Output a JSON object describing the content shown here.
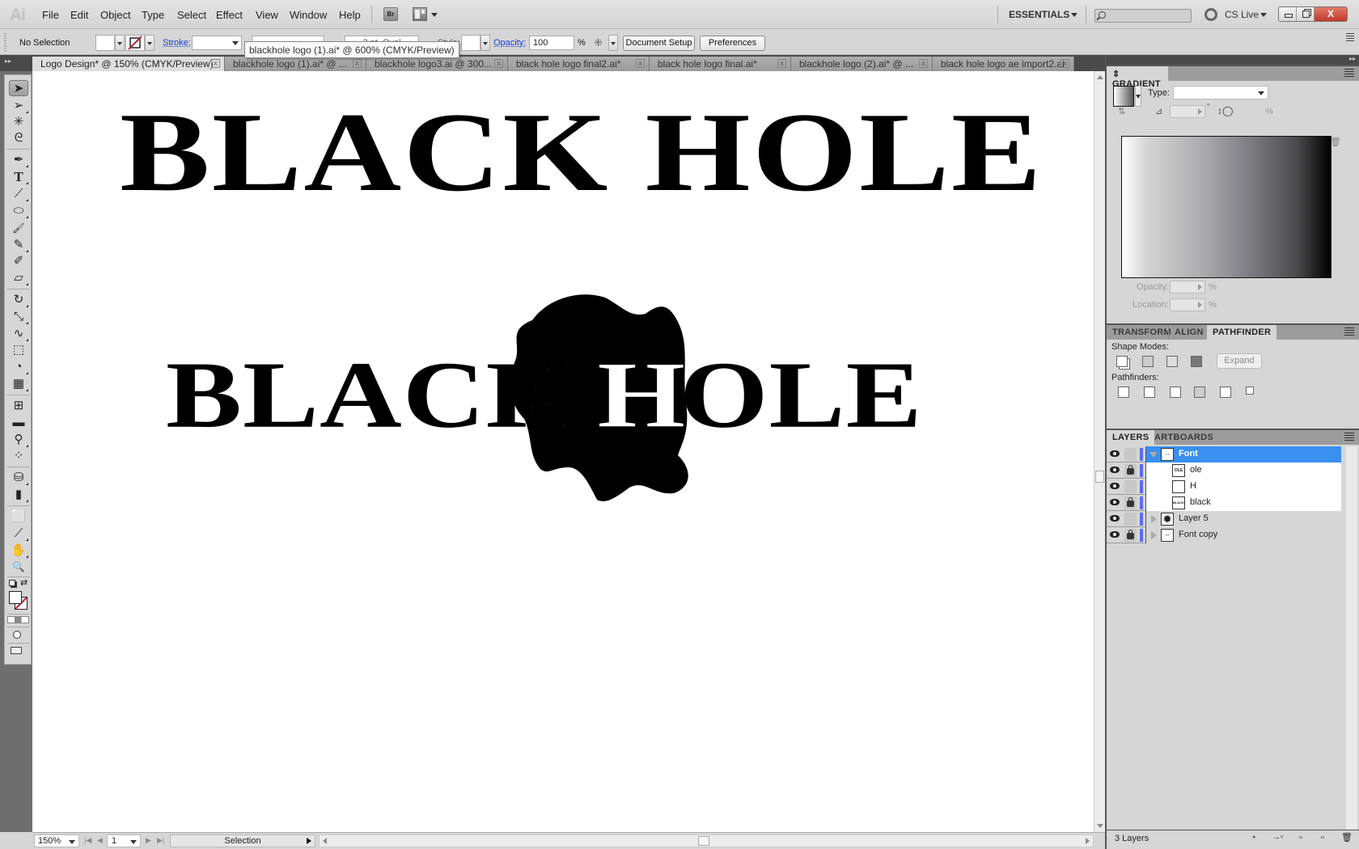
{
  "app": {
    "logo": "Ai",
    "menu": [
      "File",
      "Edit",
      "Object",
      "Type",
      "Select",
      "Effect",
      "View",
      "Window",
      "Help"
    ],
    "bridge_label": "Br",
    "workspace": "ESSENTIALS",
    "search_placeholder": "",
    "cs_live": "CS Live",
    "close_glyph": "X"
  },
  "control_bar": {
    "selection": "No Selection",
    "stroke_label": "Stroke:",
    "brush_value": "3 pt. Oval",
    "style_label": "Style:",
    "opacity_label": "Opacity:",
    "opacity_value": "100",
    "opacity_unit": "%",
    "document_setup": "Document Setup",
    "preferences": "Preferences"
  },
  "tooltip": "blackhole logo (1).ai* @ 600% (CMYK/Preview)",
  "tabs": [
    {
      "label": "Logo Design* @ 150% (CMYK/Preview)",
      "active": true
    },
    {
      "label": "blackhole logo (1).ai* @ ..."
    },
    {
      "label": "blackhole logo3.ai @ 300..."
    },
    {
      "label": "black hole logo final2.ai*"
    },
    {
      "label": "black hole logo final.ai*"
    },
    {
      "label": "blackhole logo (2).ai* @ ..."
    },
    {
      "label": "black hole logo ae import2.ai"
    }
  ],
  "tab_close_glyph": "x",
  "tools": [
    {
      "name": "selection-tool",
      "glyph": "➤"
    },
    {
      "name": "direct-selection-tool",
      "glyph": "➢"
    },
    {
      "name": "magic-wand-tool",
      "glyph": "✳"
    },
    {
      "name": "lasso-tool",
      "glyph": "ᘓ"
    },
    {
      "name": "pen-tool",
      "glyph": "✒"
    },
    {
      "name": "type-tool",
      "glyph": "T"
    },
    {
      "name": "line-segment-tool",
      "glyph": "⟋"
    },
    {
      "name": "ellipse-tool",
      "glyph": "⬭"
    },
    {
      "name": "paintbrush-tool",
      "glyph": "🖌"
    },
    {
      "name": "pencil-tool",
      "glyph": "✎"
    },
    {
      "name": "blob-brush-tool",
      "glyph": "✐"
    },
    {
      "name": "eraser-tool",
      "glyph": "▱"
    },
    {
      "name": "rotate-tool",
      "glyph": "↻"
    },
    {
      "name": "scale-tool",
      "glyph": "⤡"
    },
    {
      "name": "warp-tool",
      "glyph": "∿"
    },
    {
      "name": "free-transform-tool",
      "glyph": "⬚"
    },
    {
      "name": "shape-builder-tool",
      "glyph": "◔"
    },
    {
      "name": "perspective-grid-tool",
      "glyph": "▦"
    },
    {
      "name": "mesh-tool",
      "glyph": "⊞"
    },
    {
      "name": "gradient-tool",
      "glyph": "▬"
    },
    {
      "name": "eyedropper-tool",
      "glyph": "⚲"
    },
    {
      "name": "blend-tool",
      "glyph": "⁘"
    },
    {
      "name": "symbol-sprayer-tool",
      "glyph": "⛁"
    },
    {
      "name": "column-graph-tool",
      "glyph": "▮"
    },
    {
      "name": "artboard-tool",
      "glyph": "⬜"
    },
    {
      "name": "slice-tool",
      "glyph": "⟋"
    },
    {
      "name": "hand-tool",
      "glyph": "✋"
    },
    {
      "name": "zoom-tool",
      "glyph": "🔍"
    }
  ],
  "artwork": {
    "top_logo": "BLACK HOLE",
    "bottom_left": "BLACK",
    "bottom_right": "HOLE"
  },
  "status": {
    "zoom": "150%",
    "page": "1",
    "mode": "Selection"
  },
  "panels": {
    "gradient": {
      "title": "GRADIENT",
      "type_label": "Type:",
      "type_value": "",
      "percent": "%",
      "degree": "°",
      "opacity_label": "Opacity:",
      "location_label": "Location:"
    },
    "group2": {
      "tabs": [
        "TRANSFORM",
        "ALIGN",
        "PATHFINDER"
      ],
      "active": "PATHFINDER",
      "shape_modes_label": "Shape Modes:",
      "expand": "Expand",
      "pathfinders_label": "Pathfinders:"
    },
    "layers": {
      "tabs": [
        "LAYERS",
        "ARTBOARDS"
      ],
      "rows": [
        {
          "name": "Font",
          "thumb": "- -",
          "level": 0,
          "expanded": true,
          "locked": false,
          "selected": true
        },
        {
          "name": "ole",
          "thumb": "OLE",
          "level": 1,
          "locked": true
        },
        {
          "name": "H",
          "thumb": "",
          "level": 1,
          "locked": false
        },
        {
          "name": "black",
          "thumb": "BLACK",
          "level": 1,
          "locked": true
        },
        {
          "name": "Layer 5",
          "thumb": "✹",
          "level": 0,
          "expanded": false,
          "locked": false
        },
        {
          "name": "Font copy",
          "thumb": "---",
          "level": 0,
          "expanded": false,
          "locked": true
        }
      ],
      "count": "3 Layers"
    }
  }
}
